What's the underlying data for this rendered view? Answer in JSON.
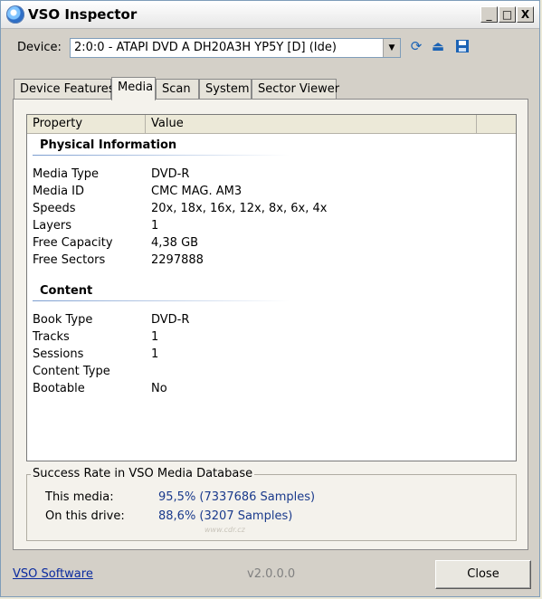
{
  "window": {
    "title": "VSO Inspector",
    "minimize_label": "_",
    "maximize_label": "□",
    "close_label": "X"
  },
  "device": {
    "label": "Device:",
    "selected": "2:0:0 - ATAPI DVD A  DH20A3H YP5Y [D] (Ide)",
    "toolbar_icons": [
      "refresh-icon",
      "eject-icon",
      "save-icon"
    ]
  },
  "tabs": [
    {
      "label": "Device Features",
      "active": false
    },
    {
      "label": "Media",
      "active": true
    },
    {
      "label": "Scan",
      "active": false
    },
    {
      "label": "System",
      "active": false
    },
    {
      "label": "Sector Viewer",
      "active": false
    }
  ],
  "list": {
    "columns": [
      "Property",
      "Value"
    ],
    "groups": [
      {
        "title": "Physical Information",
        "rows": [
          {
            "property": "Media Type",
            "value": "DVD-R"
          },
          {
            "property": "Media ID",
            "value": "CMC MAG. AM3"
          },
          {
            "property": "Speeds",
            "value": "20x, 18x, 16x, 12x, 8x, 6x, 4x"
          },
          {
            "property": "Layers",
            "value": "1"
          },
          {
            "property": "Free Capacity",
            "value": "4,38 GB"
          },
          {
            "property": "Free Sectors",
            "value": "2297888"
          }
        ]
      },
      {
        "title": "Content",
        "rows": [
          {
            "property": "Book Type",
            "value": "DVD-R"
          },
          {
            "property": "Tracks",
            "value": "1"
          },
          {
            "property": "Sessions",
            "value": "1"
          },
          {
            "property": "Content Type",
            "value": ""
          },
          {
            "property": "Bootable",
            "value": "No"
          }
        ]
      }
    ]
  },
  "stats": {
    "title": "Success Rate in VSO Media Database",
    "this_media_label": "This media:",
    "this_media_value": "95,5% (7337686 Samples)",
    "this_drive_label": "On this drive:",
    "this_drive_value": "88,6% (3207 Samples)",
    "watermark": "www.cdr.cz"
  },
  "footer": {
    "link": "VSO Software",
    "version": "v2.0.0.0",
    "close_button": "Close"
  }
}
